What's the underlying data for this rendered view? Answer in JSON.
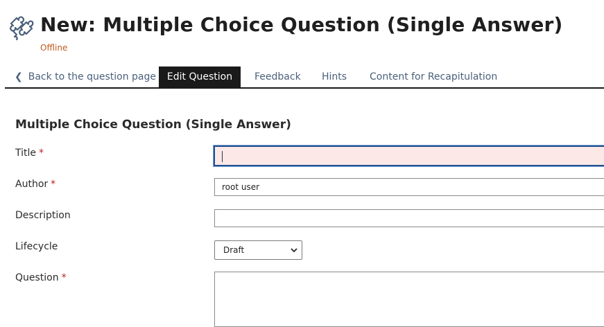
{
  "header": {
    "title": "New: Multiple Choice Question (Single Answer)",
    "status": "Offline",
    "status_color": "#c0591d",
    "icon": "puzzle-icon"
  },
  "tabs": {
    "back": "Back to the question page",
    "edit": "Edit Question",
    "feedback": "Feedback",
    "hints": "Hints",
    "content": "Content for Recapitulation"
  },
  "form": {
    "section_title": "Multiple Choice Question (Single Answer)",
    "title_label": "Title",
    "title_value": "",
    "author_label": "Author",
    "author_value": "root user",
    "description_label": "Description",
    "description_value": "",
    "lifecycle_label": "Lifecycle",
    "lifecycle_value": "Draft",
    "question_label": "Question",
    "required_mark": "*"
  }
}
